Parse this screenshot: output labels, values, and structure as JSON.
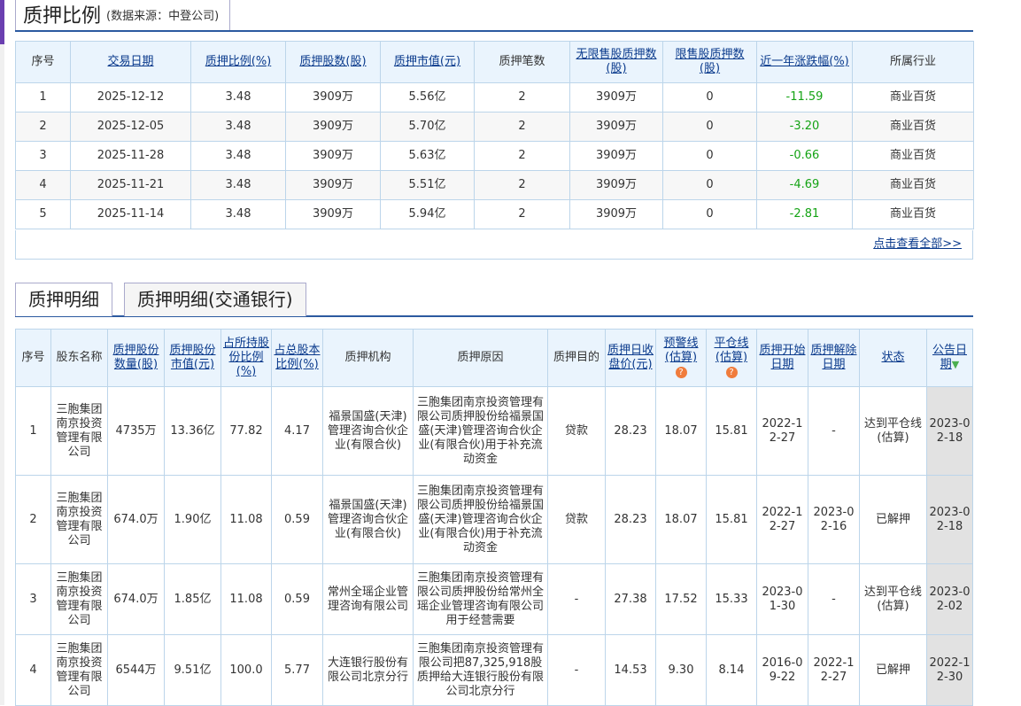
{
  "section1": {
    "title": "质押比例",
    "source": "(数据来源：中登公司)",
    "more": "点击查看全部>>",
    "headers": [
      "序号",
      "交易日期",
      "质押比例(%)",
      "质押股数(股)",
      "质押市值(元)",
      "质押笔数",
      "无限售股质押数(股)",
      "限售股质押数(股)",
      "近一年涨跌幅(%)",
      "所属行业"
    ],
    "rows": [
      [
        "1",
        "2025-12-12",
        "3.48",
        "3909万",
        "5.56亿",
        "2",
        "3909万",
        "0",
        "-11.59",
        "商业百货"
      ],
      [
        "2",
        "2025-12-05",
        "3.48",
        "3909万",
        "5.70亿",
        "2",
        "3909万",
        "0",
        "-3.20",
        "商业百货"
      ],
      [
        "3",
        "2025-11-28",
        "3.48",
        "3909万",
        "5.63亿",
        "2",
        "3909万",
        "0",
        "-0.66",
        "商业百货"
      ],
      [
        "4",
        "2025-11-21",
        "3.48",
        "3909万",
        "5.51亿",
        "2",
        "3909万",
        "0",
        "-4.69",
        "商业百货"
      ],
      [
        "5",
        "2025-11-14",
        "3.48",
        "3909万",
        "5.94亿",
        "2",
        "3909万",
        "0",
        "-2.81",
        "商业百货"
      ]
    ]
  },
  "section2": {
    "tabs": [
      "质押明细",
      "质押明细(交通银行)"
    ],
    "headers": [
      "序号",
      "股东名称",
      "质押股份数量(股)",
      "质押股份市值(元)",
      "占所持股份比例(%)",
      "占总股本比例(%)",
      "质押机构",
      "质押原因",
      "质押目的",
      "质押日收盘价(元)",
      "预警线(估算)",
      "平仓线(估算)",
      "质押开始日期",
      "质押解除日期",
      "状态",
      "公告日期"
    ],
    "help": "?",
    "rows": [
      [
        "1",
        "三胞集团南京投资管理有限公司",
        "4735万",
        "13.36亿",
        "77.82",
        "4.17",
        "福景国盛(天津)管理咨询合伙企业(有限合伙)",
        "三胞集团南京投资管理有限公司质押股份给福景国盛(天津)管理咨询合伙企业(有限合伙)用于补充流动资金",
        "贷款",
        "28.23",
        "18.07",
        "15.81",
        "2022-12-27",
        "-",
        "达到平仓线(估算)",
        "2023-02-18"
      ],
      [
        "2",
        "三胞集团南京投资管理有限公司",
        "674.0万",
        "1.90亿",
        "11.08",
        "0.59",
        "福景国盛(天津)管理咨询合伙企业(有限合伙)",
        "三胞集团南京投资管理有限公司质押股份给福景国盛(天津)管理咨询合伙企业(有限合伙)用于补充流动资金",
        "贷款",
        "28.23",
        "18.07",
        "15.81",
        "2022-12-27",
        "2023-02-16",
        "已解押",
        "2023-02-18"
      ],
      [
        "3",
        "三胞集团南京投资管理有限公司",
        "674.0万",
        "1.85亿",
        "11.08",
        "0.59",
        "常州全瑶企业管理咨询有限公司",
        "三胞集团南京投资管理有限公司质押股份给常州全瑶企业管理咨询有限公司用于经营需要",
        "-",
        "27.38",
        "17.52",
        "15.33",
        "2023-01-30",
        "-",
        "达到平仓线(估算)",
        "2023-02-02"
      ],
      [
        "4",
        "三胞集团南京投资管理有限公司",
        "6544万",
        "9.51亿",
        "100.0",
        "5.77",
        "大连银行股份有限公司北京分行",
        "三胞集团南京投资管理有限公司把87,325,918股质押给大连银行股份有限公司北京分行",
        "-",
        "14.53",
        "9.30",
        "8.14",
        "2016-09-22",
        "2022-12-27",
        "已解押",
        "2022-12-30"
      ]
    ]
  }
}
